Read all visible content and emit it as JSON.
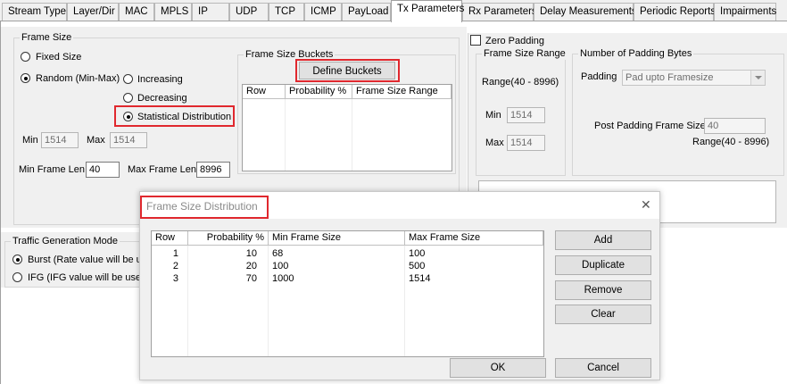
{
  "tabs": [
    "Stream Type",
    "Layer/Dir",
    "MAC",
    "MPLS",
    "IP",
    "UDP",
    "TCP",
    "ICMP",
    "PayLoad",
    "Tx Parameters",
    "Rx Parameters",
    "Delay Measurements",
    "Periodic Reports",
    "Impairments"
  ],
  "active_tab": "Tx Parameters",
  "frame_size": {
    "title": "Frame Size",
    "fixed_label": "Fixed Size",
    "random_label": "Random (Min-Max)",
    "increasing_label": "Increasing",
    "decreasing_label": "Decreasing",
    "statistical_label": "Statistical Distribution",
    "min_label": "Min",
    "min_value": "1514",
    "max_label": "Max",
    "max_value": "1514",
    "min_frame_len_label": "Min Frame Len",
    "min_frame_len_value": "40",
    "max_frame_len_label": "Max Frame Len",
    "max_frame_len_value": "8996"
  },
  "buckets": {
    "title": "Frame Size Buckets",
    "define_label": "Define Buckets",
    "columns": [
      "Row",
      "Probability %",
      "Frame Size Range"
    ]
  },
  "zero_padding": {
    "label": "Zero Padding",
    "range_group_title": "Frame Size Range",
    "range_text": "Range(40 - 8996)",
    "min_label": "Min",
    "min_value": "1514",
    "max_label": "Max",
    "max_value": "1514",
    "bytes_group_title": "Number of Padding Bytes",
    "padding_label": "Padding",
    "padding_value": "Pad upto Framesize",
    "post_padding_label": "Post Padding Frame Size",
    "post_padding_value": "40",
    "post_range_text": "Range(40 - 8996)"
  },
  "traffic": {
    "title": "Traffic Generation Mode",
    "burst_label": "Burst (Rate value will be us",
    "ifg_label": "IFG (IFG value will be used"
  },
  "dialog": {
    "title": "Frame Size Distribution",
    "close_glyph": "✕",
    "columns": [
      "Row",
      "Probability %",
      "Min Frame Size",
      "Max Frame Size"
    ],
    "rows": [
      {
        "row": "1",
        "probability": "10",
        "min": "68",
        "max": "100"
      },
      {
        "row": "2",
        "probability": "20",
        "min": "100",
        "max": "500"
      },
      {
        "row": "3",
        "probability": "70",
        "min": "1000",
        "max": "1514"
      }
    ],
    "add_label": "Add",
    "duplicate_label": "Duplicate",
    "remove_label": "Remove",
    "clear_label": "Clear",
    "ok_label": "OK",
    "cancel_label": "Cancel"
  },
  "colors": {
    "highlight": "#e0282e",
    "dialog_title": "#8a8a8a",
    "disabled_text": "#6d6d6d"
  }
}
